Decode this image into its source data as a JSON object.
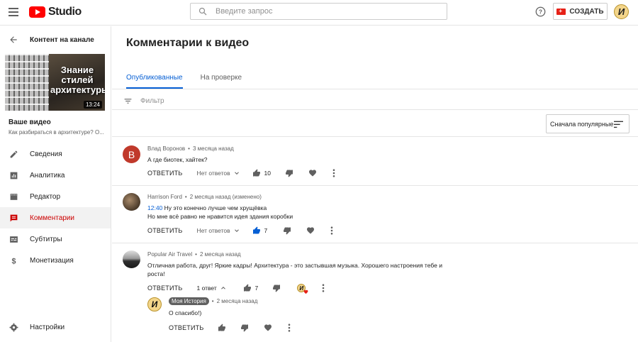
{
  "header": {
    "logo_text": "Studio",
    "search_placeholder": "Введите запрос",
    "create_label": "СОЗДАТЬ",
    "avatar_letter": "И"
  },
  "sidebar": {
    "back_label": "Контент на канале",
    "thumb_title": "Знание стилей архитектуры",
    "duration": "13:24",
    "your_video": "Ваше видео",
    "video_title": "Как разбираться в архитектуре? О...",
    "items": [
      {
        "label": "Сведения",
        "icon": "pencil-icon"
      },
      {
        "label": "Аналитика",
        "icon": "analytics-icon"
      },
      {
        "label": "Редактор",
        "icon": "film-icon"
      },
      {
        "label": "Комментарии",
        "icon": "comments-icon",
        "active": true
      },
      {
        "label": "Субтитры",
        "icon": "subtitles-icon"
      },
      {
        "label": "Монетизация",
        "icon": "dollar-icon"
      }
    ],
    "settings_label": "Настройки"
  },
  "main": {
    "title": "Комментарии к видео",
    "tabs": [
      {
        "label": "Опубликованные",
        "active": true
      },
      {
        "label": "На проверке",
        "active": false
      }
    ],
    "filter_placeholder": "Фильтр",
    "sort_label": "Сначала популярные"
  },
  "comments": [
    {
      "author": "Влад Воронов",
      "time": "3 месяца назад",
      "avatar_letter": "В",
      "avatar_color": "#c0392b",
      "text": "А где биотек, хайтек?",
      "reply_label": "ОТВЕТИТЬ",
      "replies": "Нет ответов",
      "likes": "10"
    },
    {
      "author": "Harrison Ford",
      "time": "2 месяца назад (изменено)",
      "timestamp": "12:40",
      "text1": "Ну это конечно лучше чем хрущёвка",
      "text2": "Но мне всё равно не нравится идея здания коробки",
      "reply_label": "ОТВЕТИТЬ",
      "replies": "Нет ответов",
      "likes": "7"
    },
    {
      "author": "Popular Air Travel",
      "time": "2 месяца назад",
      "text": "Отличная работа, друг! Яркие кадры! Архитектура - это застывшая музыка. Хорошего настроения тебе и роста!",
      "reply_label": "ОТВЕТИТЬ",
      "replies": "1 ответ",
      "likes": "7"
    }
  ],
  "reply": {
    "author": "Моя История",
    "time": "2 месяца назад",
    "avatar_letter": "И",
    "text": "О спасибо!)",
    "reply_label": "ОТВЕТИТЬ"
  },
  "colors": {
    "accent": "#065fd4",
    "active_nav": "#cc0000",
    "brand": "#ff0000"
  }
}
